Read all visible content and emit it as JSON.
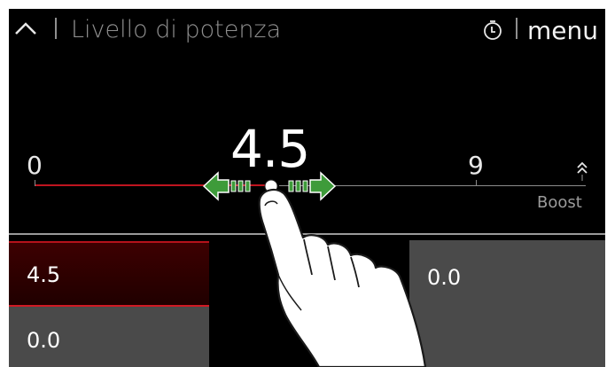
{
  "header": {
    "title": "Livello di potenza",
    "menu_label": "menu",
    "icons": {
      "back": "chevron-up-icon",
      "timer": "timer-icon"
    }
  },
  "slider": {
    "current_value": "4.5",
    "min_label": "0",
    "max_label": "9",
    "boost_label": "Boost",
    "level": 4.5,
    "max": 9,
    "accent_color": "#c0141f",
    "arrow_color": "#3e9b3a"
  },
  "zones": [
    {
      "value": "4.5",
      "state": "active"
    },
    {
      "value": "0.0",
      "state": "inactive"
    },
    {
      "value": "0.0",
      "state": "inactive"
    }
  ]
}
